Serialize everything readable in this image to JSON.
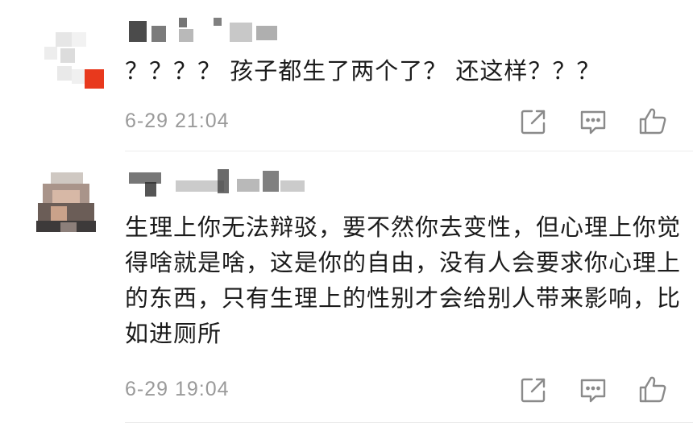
{
  "comments": [
    {
      "text": "？？？？ 孩子都生了两个了？ 还这样？？？",
      "time": "6-29 21:04",
      "actions": [
        "share-icon",
        "reply-icon",
        "like-icon"
      ]
    },
    {
      "text": "生理上你无法辩驳，要不然你去变性，但心理上你觉得啥就是啥，这是你的自由，没有人会要求你心理上的东西，只有生理上的性别才会给别人带来影响，比如进厕所",
      "time": "6-29 19:04",
      "actions": [
        "share-icon",
        "reply-icon",
        "like-icon"
      ]
    }
  ],
  "colors": {
    "text": "#1b1b1b",
    "meta": "#9a9a9a",
    "icon": "#8a8a8a",
    "avatar_accent": "#e8391d"
  }
}
